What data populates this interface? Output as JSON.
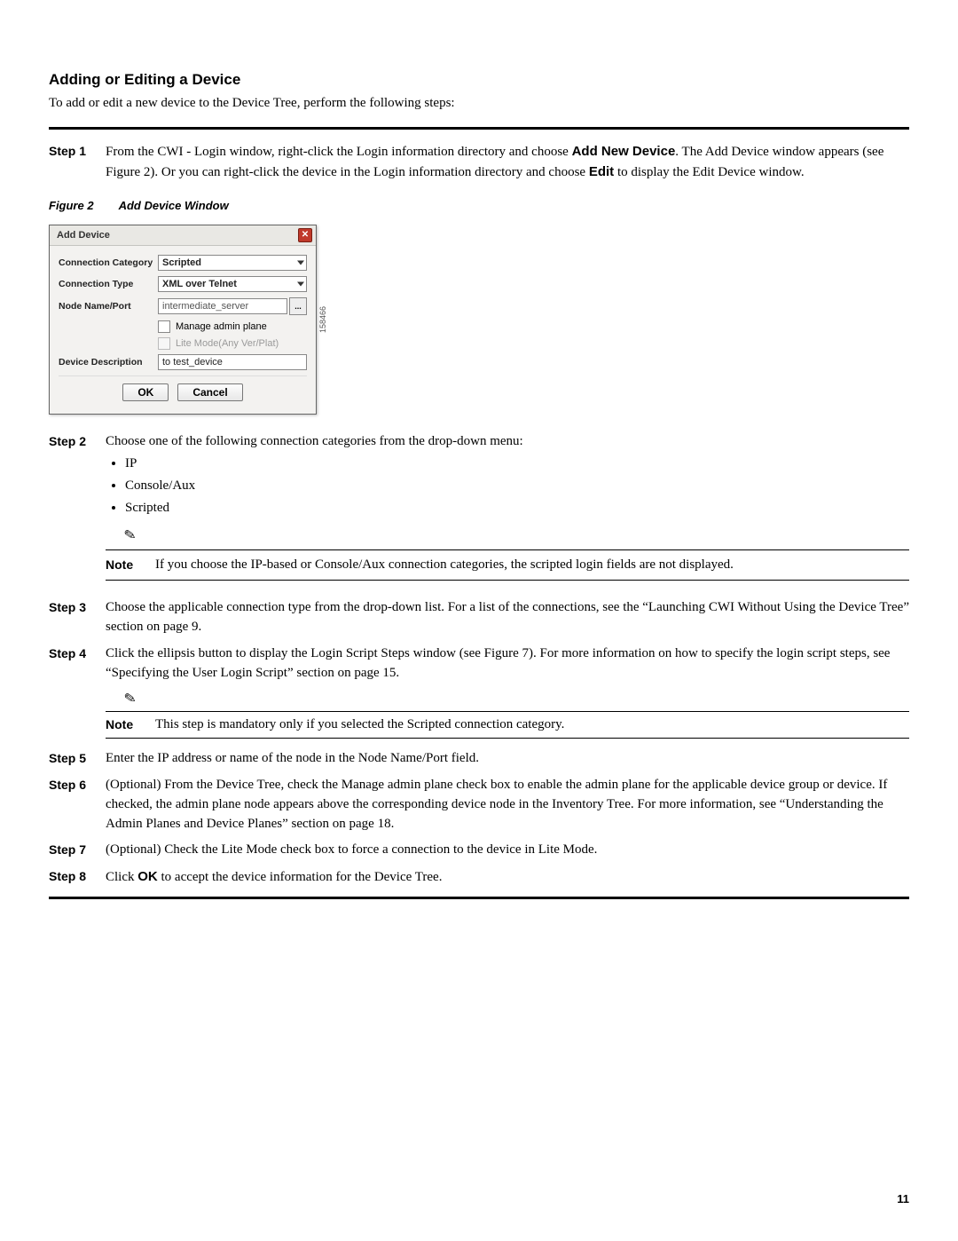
{
  "heading": "Adding or Editing a Device",
  "intro": "To add or edit a new device to the Device Tree, perform the following steps:",
  "steps": {
    "s1": {
      "label": "Step 1",
      "pre": "From the CWI - Login window, right-click the Login information directory and choose ",
      "bold1": "Add New Device",
      "mid": ". The Add Device window appears (see Figure 2). Or you can right-click the device in the Login information directory and choose ",
      "bold2": "Edit",
      "post": " to display the Edit Device window."
    },
    "s2": {
      "label": "Step 2",
      "text": "Choose one of the following connection categories from the drop-down menu:",
      "bullets": [
        "IP",
        "Console/Aux",
        "Scripted"
      ],
      "note": "If you choose the IP-based or Console/Aux connection categories, the scripted login fields are not displayed."
    },
    "s3": {
      "label": "Step 3",
      "text": "Choose the applicable connection type from the drop-down list. For a list of the connections, see the “Launching CWI Without Using the Device Tree” section on page 9."
    },
    "s4": {
      "label": "Step 4",
      "text": "Click the ellipsis button to display the Login Script Steps window (see Figure 7). For more information on how to specify the login script steps, see “Specifying the User Login Script” section on page 15.",
      "note": "This step is mandatory only if you selected the Scripted connection category."
    },
    "s5": {
      "label": "Step 5",
      "text": "Enter the IP address or name of the node in the Node Name/Port field."
    },
    "s6": {
      "label": "Step 6",
      "text": "(Optional) From the Device Tree, check the Manage admin plane check box to enable the admin plane for the applicable device group or device. If checked, the admin plane node appears above the corresponding device node in the Inventory Tree. For more information, see “Understanding the Admin Planes and Device Planes” section on page 18."
    },
    "s7": {
      "label": "Step 7",
      "text": "(Optional) Check the Lite Mode check box to force a connection to the device in Lite Mode."
    },
    "s8": {
      "label": "Step 8",
      "pre": "Click ",
      "bold1": "OK",
      "post": " to accept the device information for the Device Tree."
    }
  },
  "figure": {
    "label_prefix": "Figure 2",
    "label_title": "Add Device Window",
    "window_title": "Add Device",
    "conn_cat_label": "Connection Category",
    "conn_cat_value": "Scripted",
    "conn_type_label": "Connection Type",
    "conn_type_value": "XML over Telnet",
    "node_label": "Node Name/Port",
    "node_value": "intermediate_server",
    "ellipsis": "...",
    "check_manage": "Manage admin plane",
    "check_lite": "Lite Mode(Any Ver/Plat)",
    "desc_label": "Device Description",
    "desc_value": "to test_device",
    "ok": "OK",
    "cancel": "Cancel",
    "fig_id": "158466"
  },
  "note_label": "Note",
  "page_number": "11"
}
